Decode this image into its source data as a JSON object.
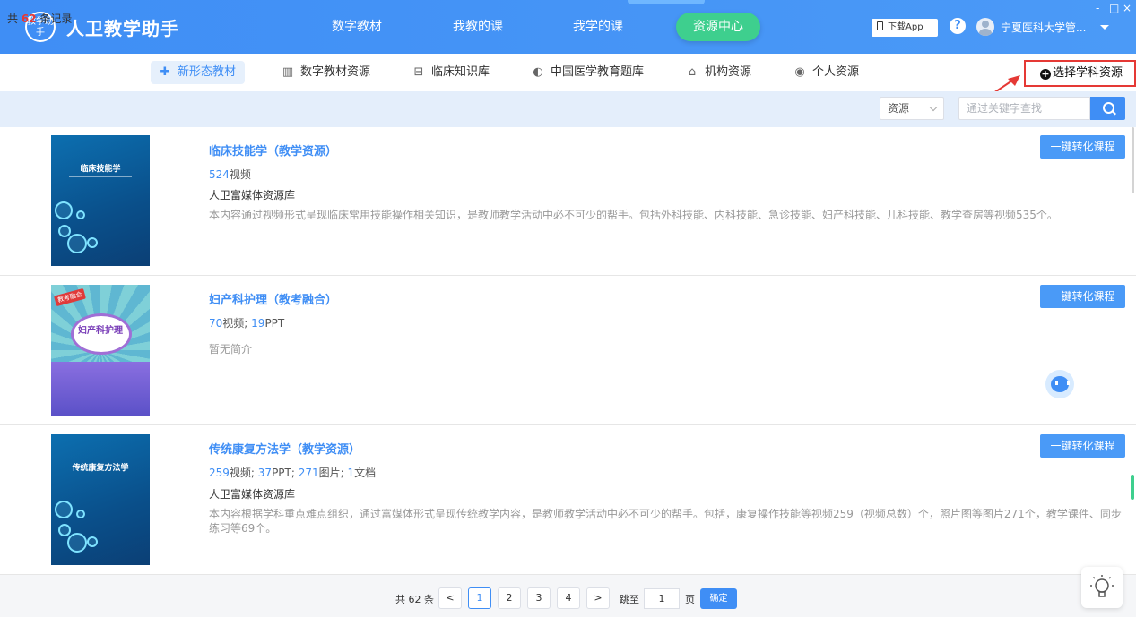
{
  "header": {
    "logo_text": "教学助手",
    "app_title": "人卫教学助手",
    "nav": [
      {
        "label": "数字教材",
        "active": false
      },
      {
        "label": "我教的课",
        "active": false
      },
      {
        "label": "我学的课",
        "active": false
      },
      {
        "label": "资源中心",
        "active": true
      }
    ],
    "download_label": "下载App",
    "help_label": "?",
    "username": "宁夏医科大学管...",
    "window_controls": [
      "-",
      "□",
      "×"
    ]
  },
  "tabs": [
    {
      "label": "新形态教材",
      "icon": "medkit-icon",
      "active": true
    },
    {
      "label": "数字教材资源",
      "icon": "book-icon",
      "active": false
    },
    {
      "label": "临床知识库",
      "icon": "bed-icon",
      "active": false
    },
    {
      "label": "中国医学教育题库",
      "icon": "pill-icon",
      "active": false
    },
    {
      "label": "机构资源",
      "icon": "institution-icon",
      "active": false
    },
    {
      "label": "个人资源",
      "icon": "person-icon",
      "active": false
    }
  ],
  "select_subject_label": "选择学科资源",
  "filter": {
    "count_prefix": "共",
    "count": "62",
    "count_suffix": "条记录",
    "type_select": "资源",
    "search_placeholder": "通过关键字查找"
  },
  "items": [
    {
      "title": "临床技能学（教学资源）",
      "cover_title": "临床技能学",
      "stats": [
        {
          "num": "524",
          "unit": "视频"
        }
      ],
      "source": "人卫富媒体资源库",
      "description": "本内容通过视频形式呈现临床常用技能操作相关知识，是教师教学活动中必不可少的帮手。包括外科技能、内科技能、急诊技能、妇产科技能、儿科技能、教学查房等视频535个。",
      "button": "一键转化课程"
    },
    {
      "title": "妇产科护理（教考融合）",
      "cover_title": "妇产科护理",
      "cover_badge": "教考融合",
      "stats": [
        {
          "num": "70",
          "unit": "视频"
        },
        {
          "num": "19",
          "unit": "PPT"
        }
      ],
      "source": "",
      "description": "暂无简介",
      "button": "一键转化课程"
    },
    {
      "title": "传统康复方法学（教学资源）",
      "cover_title": "传统康复方法学",
      "stats": [
        {
          "num": "259",
          "unit": "视频"
        },
        {
          "num": "37",
          "unit": "PPT"
        },
        {
          "num": "271",
          "unit": "图片"
        },
        {
          "num": "1",
          "unit": "文档"
        }
      ],
      "source": "人卫富媒体资源库",
      "description": "本内容根据学科重点难点组织，通过富媒体形式呈现传统教学内容，是教师教学活动中必不可少的帮手。包括，康复操作技能等视频259（视频总数）个，照片图等图片271个，教学课件、同步练习等69个。",
      "button": "一键转化课程"
    }
  ],
  "pagination": {
    "total": "共 62 条",
    "prev": "<",
    "pages": [
      "1",
      "2",
      "3",
      "4"
    ],
    "current": "1",
    "next": ">",
    "jump_label": "跳至",
    "jump_value": "1",
    "page_label": "页",
    "confirm": "确定"
  },
  "colors": {
    "primary": "#3f8ef5",
    "active_nav": "#3ecf8e",
    "highlight": "#e53935"
  }
}
